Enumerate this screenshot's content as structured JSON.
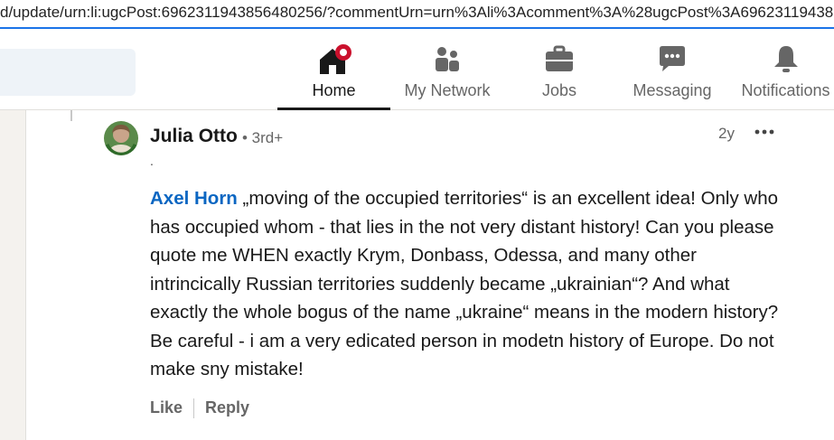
{
  "browser": {
    "url": "d/update/urn:li:ugcPost:6962311943856480256/?commentUrn=urn%3Ali%3Acomment%3A%28ugcPost%3A69623119438564"
  },
  "nav": {
    "home": "Home",
    "network": "My Network",
    "jobs": "Jobs",
    "messaging": "Messaging",
    "notifications": "Notifications",
    "notification_dot_color": "#cb112d"
  },
  "comment": {
    "author": "Julia Otto",
    "degree": "• 3rd+",
    "time": "2y",
    "headline": ".",
    "mention": "Axel Horn",
    "text": " „moving of the occupied territories“ is an excellent idea! Only who has occupied whom - that lies in the not very distant history! Can you please quote me WHEN exactly Krym, Donbass, Odessa, and many other intrincically Russian territories suddenly became „ukrainian“? And what exactly the whole bogus of the name „ukraine“ means in the modern history? Be careful - i am a very edicated person in modetn history of Europe. Do not make sny mistake!",
    "like": "Like",
    "reply": "Reply"
  }
}
